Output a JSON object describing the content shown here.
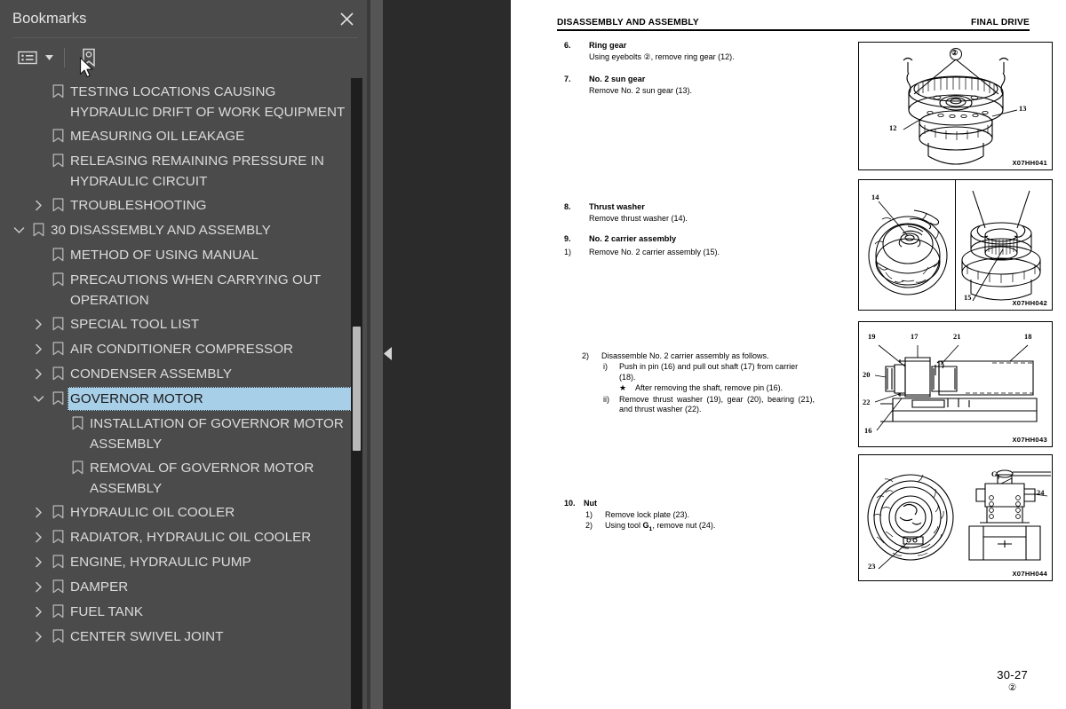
{
  "sidebar": {
    "title": "Bookmarks",
    "close_icon": "close-icon",
    "toolbar": {
      "list_view_icon": "list-view-icon",
      "dropdown_caret_icon": "chevron-down-icon",
      "new_bookmark_icon": "new-bookmark-icon"
    },
    "items": [
      {
        "label": "TESTING LOCATIONS CAUSING HYDRAULIC DRIFT OF WORK EQUIPMENT",
        "level": 1,
        "twisty": "none",
        "selected": false
      },
      {
        "label": "MEASURING OIL LEAKAGE",
        "level": 1,
        "twisty": "none",
        "selected": false
      },
      {
        "label": "RELEASING REMAINING PRESSURE IN HYDRAULIC CIRCUIT",
        "level": 1,
        "twisty": "none",
        "selected": false
      },
      {
        "label": "TROUBLESHOOTING",
        "level": 1,
        "twisty": "collapsed",
        "selected": false
      },
      {
        "label": "30 DISASSEMBLY AND ASSEMBLY",
        "level": 0,
        "twisty": "expanded",
        "selected": false
      },
      {
        "label": "METHOD OF USING MANUAL",
        "level": 1,
        "twisty": "none",
        "selected": false
      },
      {
        "label": "PRECAUTIONS WHEN CARRYING OUT OPERATION",
        "level": 1,
        "twisty": "none",
        "selected": false
      },
      {
        "label": "SPECIAL TOOL LIST",
        "level": 1,
        "twisty": "collapsed",
        "selected": false
      },
      {
        "label": "AIR CONDITIONER COMPRESSOR",
        "level": 1,
        "twisty": "collapsed",
        "selected": false
      },
      {
        "label": "CONDENSER ASSEMBLY",
        "level": 1,
        "twisty": "collapsed",
        "selected": false
      },
      {
        "label": "GOVERNOR MOTOR",
        "level": 1,
        "twisty": "expanded",
        "selected": true
      },
      {
        "label": "INSTALLATION OF GOVERNOR MOTOR ASSEMBLY",
        "level": 2,
        "twisty": "none",
        "selected": false
      },
      {
        "label": "REMOVAL OF GOVERNOR MOTOR ASSEMBLY",
        "level": 2,
        "twisty": "none",
        "selected": false
      },
      {
        "label": "HYDRAULIC OIL COOLER",
        "level": 1,
        "twisty": "collapsed",
        "selected": false
      },
      {
        "label": "RADIATOR, HYDRAULIC OIL COOLER",
        "level": 1,
        "twisty": "collapsed",
        "selected": false
      },
      {
        "label": "ENGINE, HYDRAULIC PUMP",
        "level": 1,
        "twisty": "collapsed",
        "selected": false
      },
      {
        "label": "DAMPER",
        "level": 1,
        "twisty": "collapsed",
        "selected": false
      },
      {
        "label": "FUEL TANK",
        "level": 1,
        "twisty": "collapsed",
        "selected": false
      },
      {
        "label": "CENTER SWIVEL JOINT",
        "level": 1,
        "twisty": "collapsed",
        "selected": false
      }
    ],
    "colors": {
      "panel_bg": "#4b4b4b",
      "selection_bg": "#a8cfe8",
      "text": "#dcdcdc",
      "scrollbar_thumb": "#b8b8b8"
    }
  },
  "splitter": {
    "collapse_icon": "triangle-left-icon"
  },
  "document": {
    "header_left": "DISASSEMBLY AND ASSEMBLY",
    "header_right": "FINAL DRIVE",
    "steps": [
      {
        "num": "6.",
        "title": "Ring gear",
        "text": "Using eyebolts ②, remove ring gear (12)."
      },
      {
        "num": "7.",
        "title": "No. 2 sun gear",
        "text": "Remove No. 2 sun gear (13)."
      },
      {
        "num": "8.",
        "title": "Thrust washer",
        "text": "Remove thrust washer (14)."
      },
      {
        "num": "9.",
        "title": "No. 2 carrier assembly",
        "sub_num": "1)",
        "text": "Remove No. 2 carrier assembly (15)."
      }
    ],
    "carrier_detail": {
      "marker": "2)",
      "intro": "Disassemble No. 2 carrier assembly as follows.",
      "sub_i_marker": "i)",
      "sub_i_text": "Push in pin (16) and pull out shaft (17) from carrier (18).",
      "star_marker": "★",
      "star_text": "After removing the shaft, remove pin (16).",
      "sub_ii_marker": "ii)",
      "sub_ii_text": "Remove thrust washer (19), gear (20), bearing (21), and thrust washer (22)."
    },
    "step_nut": {
      "num": "10.",
      "title": "Nut",
      "line1_marker": "1)",
      "line1_text": "Remove lock plate (23).",
      "line2_marker": "2)",
      "line2_text_a": "Using tool ",
      "line2_tool": "G",
      "line2_tool_sub": "1",
      "line2_text_b": ", remove nut (24)."
    },
    "figures": [
      {
        "code": "X07HH041",
        "labels": [
          "②",
          "12",
          "13"
        ],
        "caption_parts": [
          "ring-gear-lifted-by-eyebolts"
        ]
      },
      {
        "code": "X07HH042",
        "labels": [
          "14",
          "15"
        ],
        "caption_parts": [
          "thrust-washer-removal",
          "no2-carrier-assembly-removal"
        ]
      },
      {
        "code": "X07HH043",
        "labels": [
          "19",
          "17",
          "21",
          "18",
          "20",
          "22",
          "16"
        ],
        "caption_parts": [
          "carrier-cross-section"
        ]
      },
      {
        "code": "X07HH044",
        "labels": [
          "G1",
          "24",
          "23"
        ],
        "caption_parts": [
          "lock-plate-and-nut-removal"
        ]
      }
    ],
    "footer": {
      "page_number": "30-27",
      "revision": "②"
    }
  }
}
